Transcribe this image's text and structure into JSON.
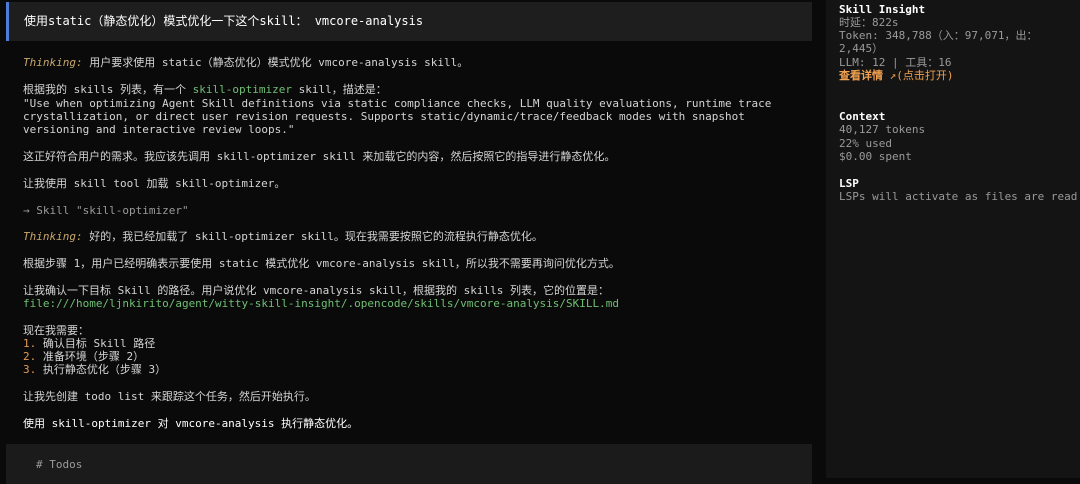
{
  "user_message": "使用static（静态优化）模式优化一下这个skill： vmcore-analysis",
  "conversation": {
    "thinking_label": "Thinking:",
    "t1": "用户要求使用 static（静态优化）模式优化 vmcore-analysis skill。",
    "p1a": "根据我的 skills 列表，有一个 ",
    "p1_skill": "skill-optimizer",
    "p1b": " skill，描述是：",
    "quote_1": "\"Use when optimizing Agent Skill definitions via static compliance checks, LLM quality evaluations, runtime trace",
    "quote_2": "crystallization, or direct user revision requests. Supports static/dynamic/trace/feedback modes with snapshot",
    "quote_3": "versioning and interactive review loops.\"",
    "p2": "这正好符合用户的需求。我应该先调用 skill-optimizer skill 来加载它的内容，然后按照它的指导进行静态优化。",
    "p3": "让我使用 skill tool 加载 skill-optimizer。",
    "tool_call": "→ Skill \"skill-optimizer\"",
    "t2": "好的，我已经加载了 skill-optimizer skill。现在我需要按照它的流程执行静态优化。",
    "p4": "根据步骤 1，用户已经明确表示要使用 static 模式优化 vmcore-analysis skill，所以我不需要再询问优化方式。",
    "p5": "让我确认一下目标 Skill 的路径。用户说优化 vmcore-analysis skill，根据我的 skills 列表，它的位置是：",
    "path": "file:///home/ljnkirito/agent/witty-skill-insight/.opencode/skills/vmcore-analysis/SKILL.md",
    "p6": "现在我需要：",
    "steps": [
      {
        "num": "1.",
        "text": "确认目标 Skill 路径"
      },
      {
        "num": "2.",
        "text": "准备环境（步骤 2）"
      },
      {
        "num": "3.",
        "text": "执行静态优化（步骤 3）"
      }
    ],
    "p7": "让我先创建 todo list 来跟踪这个任务，然后开始执行。",
    "final": "使用 skill-optimizer 对 vmcore-analysis 执行静态优化。",
    "todos": "# Todos"
  },
  "sidebar": {
    "insight_title": "Skill Insight",
    "latency": "时延：822s",
    "token_1": "Token: 348,788（入：97,071，出：",
    "token_2": "2,445）",
    "llm_tools": "LLM: 12 | 工具：16",
    "details_link": "查看详情",
    "details_hint": "↗(点击打开)",
    "context_title": "Context",
    "context_tokens": "40,127 tokens",
    "context_used": "22% used",
    "context_spent": "$0.00 spent",
    "lsp_title": "LSP",
    "lsp_text": "LSPs will activate as files are read"
  },
  "colors": {
    "accent": "#4f7bd8",
    "thinking": "#c8a66b",
    "skill_name": "#6fbf73",
    "link": "#f0a050"
  }
}
